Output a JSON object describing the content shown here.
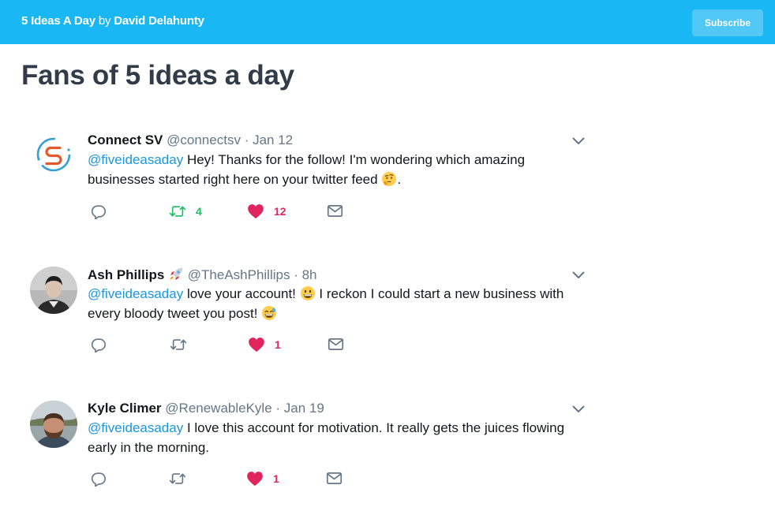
{
  "header": {
    "site_name": "5 Ideas A Day",
    "by_label": "by",
    "author": "David Delahunty",
    "subscribe_label": "Subscribe"
  },
  "page_title": "Fans of 5 ideas a day",
  "tweets": [
    {
      "name": "Connect SV",
      "handle": "@connectsv",
      "time": "· Jan 12",
      "mention": "@fiveideasaday",
      "text": " Hey! Thanks for the follow! I'm wondering which amazing businesses started right here on your twitter feed",
      "text_end": ".",
      "retweets": "4",
      "likes": "12"
    },
    {
      "name": "Ash Phillips",
      "handle": "@TheAshPhillips",
      "time": "· 8h",
      "mention": "@fiveideasaday",
      "text_a": " love your account!",
      "text_b": " I reckon I could start a new business with every bloody tweet you post!",
      "retweets": "",
      "likes": "1"
    },
    {
      "name": "Kyle Climer",
      "handle": "@RenewableKyle",
      "time": "· Jan 19",
      "mention": "@fiveideasaday",
      "text": " I love this account for motivation. It really gets the juices flowing early in the morning.",
      "retweets": "",
      "likes": "1"
    }
  ],
  "icons": {
    "reply": "reply-icon",
    "retweet": "retweet-icon",
    "like": "heart-icon",
    "dm": "envelope-icon",
    "more": "chevron-down-icon"
  },
  "colors": {
    "header": "#1ab7f5",
    "mention": "#1b95e0",
    "retweet": "#17bf63",
    "like": "#e0245e",
    "muted": "#657786"
  }
}
